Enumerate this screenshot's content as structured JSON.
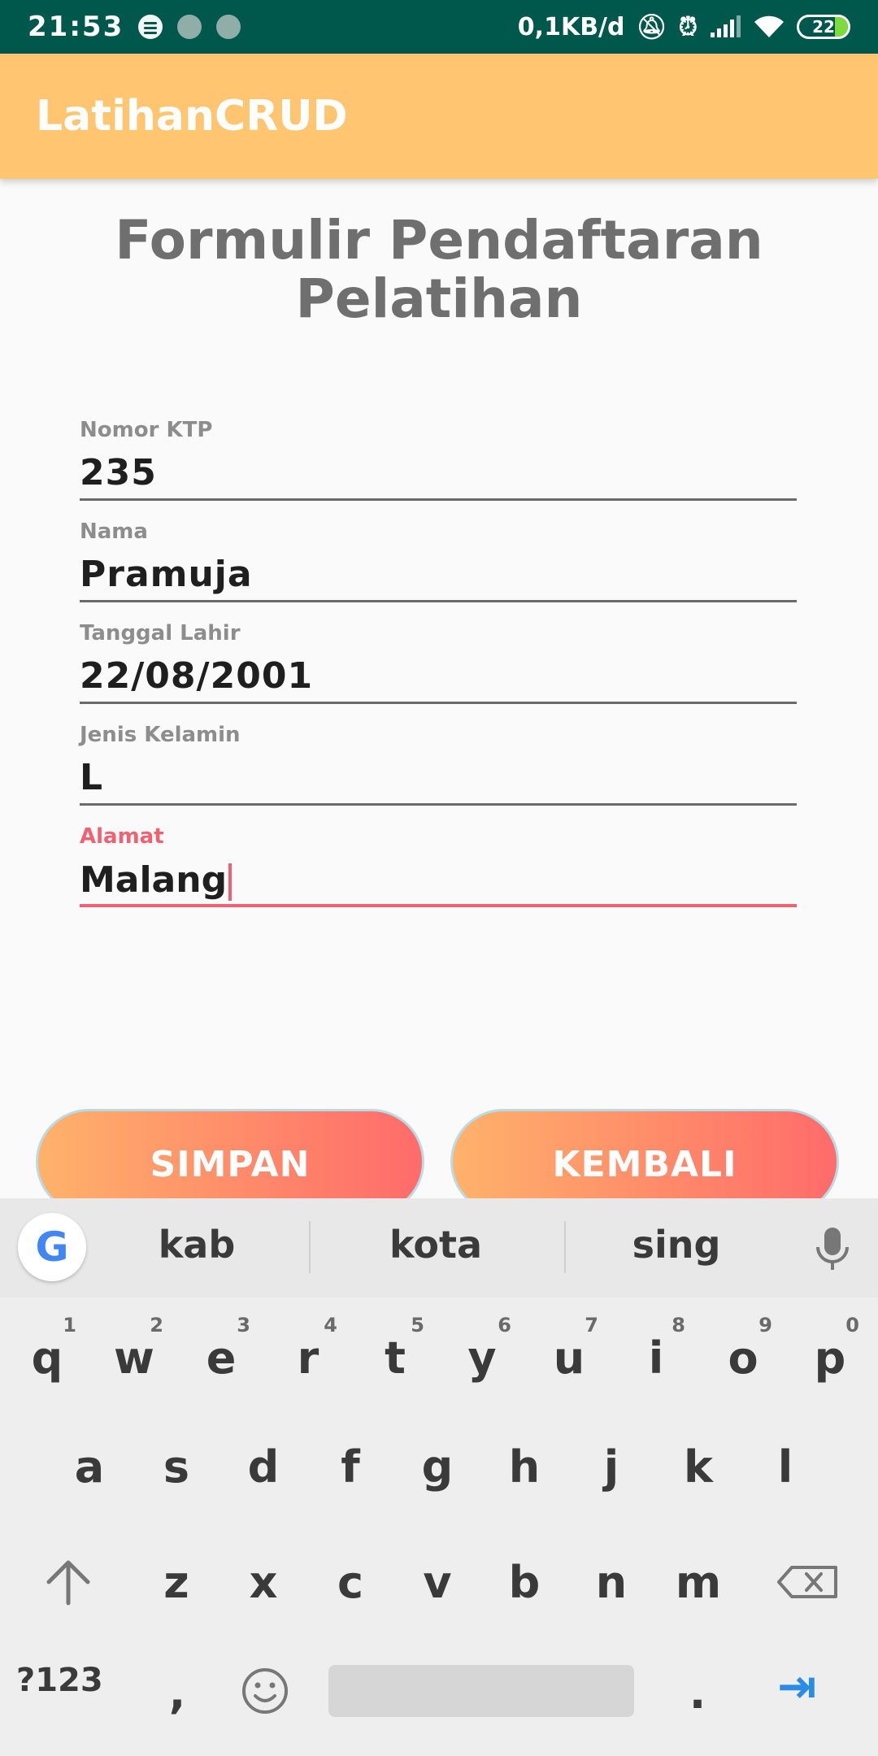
{
  "status_bar": {
    "time": "21:53",
    "net_speed": "0,1KB/d",
    "battery": "22"
  },
  "app_bar": {
    "title": "LatihanCRUD"
  },
  "form": {
    "title_line1": "Formulir Pendaftaran",
    "title_line2": "Pelatihan",
    "fields": [
      {
        "label": "Nomor KTP",
        "value": "235"
      },
      {
        "label": "Nama",
        "value": "Pramuja"
      },
      {
        "label": "Tanggal Lahir",
        "value": "22/08/2001"
      },
      {
        "label": "Jenis Kelamin",
        "value": "L"
      },
      {
        "label": "Alamat",
        "value": "Malang"
      }
    ]
  },
  "buttons": {
    "save": "SIMPAN",
    "back": "KEMBALI"
  },
  "keyboard": {
    "suggestions": [
      "kab",
      "kota",
      "sing"
    ],
    "row1": [
      "q",
      "w",
      "e",
      "r",
      "t",
      "y",
      "u",
      "i",
      "o",
      "p"
    ],
    "row1_digits": [
      "1",
      "2",
      "3",
      "4",
      "5",
      "6",
      "7",
      "8",
      "9",
      "0"
    ],
    "row2": [
      "a",
      "s",
      "d",
      "f",
      "g",
      "h",
      "j",
      "k",
      "l"
    ],
    "row3": [
      "z",
      "x",
      "c",
      "v",
      "b",
      "n",
      "m"
    ],
    "symbols_key": "?123",
    "comma": ",",
    "period": "."
  }
}
